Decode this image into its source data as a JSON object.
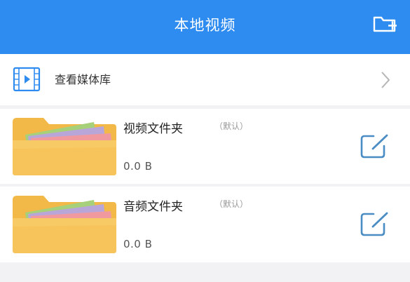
{
  "header": {
    "title": "本地视频",
    "new_folder_icon": "folder-plus-icon",
    "background": "#2e8cf0"
  },
  "media_library": {
    "label": "查看媒体库",
    "icon": "video-file-icon",
    "arrow_icon": "chevron-right-icon"
  },
  "folders": [
    {
      "name": "视频文件夹",
      "tag": "（默认）",
      "size": "0.0 B",
      "edit_icon": "edit-icon"
    },
    {
      "name": "音频文件夹",
      "tag": "（默认）",
      "size": "0.0 B",
      "edit_icon": "edit-icon"
    }
  ],
  "colors": {
    "accent": "#2e8cf0",
    "edit_icon": "#4a8cc4",
    "folder": "#f6c155",
    "page_background": "#f2f2f4"
  }
}
